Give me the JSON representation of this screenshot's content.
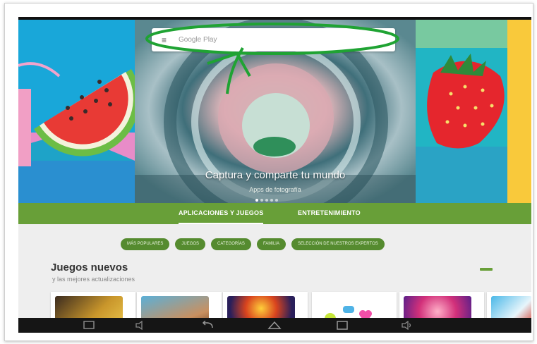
{
  "search": {
    "placeholder": "Google Play",
    "menu_icon": "menu-icon"
  },
  "hero": {
    "title": "Captura y comparte tu mundo",
    "subtitle": "Apps de fotografía",
    "dot_count": 5,
    "active_dot": 0
  },
  "tabs": [
    {
      "label": "APLICACIONES Y JUEGOS",
      "selected": true
    },
    {
      "label": "ENTRETENIMIENTO",
      "selected": false
    }
  ],
  "chips": [
    "MÁS POPULARES",
    "JUEGOS",
    "CATEGORÍAS",
    "FAMILIA",
    "SELECCIÓN DE NUESTROS EXPERTOS"
  ],
  "section": {
    "title": "Juegos nuevos",
    "subtitle": "y las mejores actualizaciones"
  },
  "colors": {
    "accent": "#689f38",
    "chip": "#558b2f",
    "navbar": "#151515"
  },
  "icons": [
    "menu-icon",
    "more-icon",
    "screenshot-icon",
    "volume-down-icon",
    "back-icon",
    "home-icon",
    "recents-icon",
    "volume-up-icon"
  ]
}
